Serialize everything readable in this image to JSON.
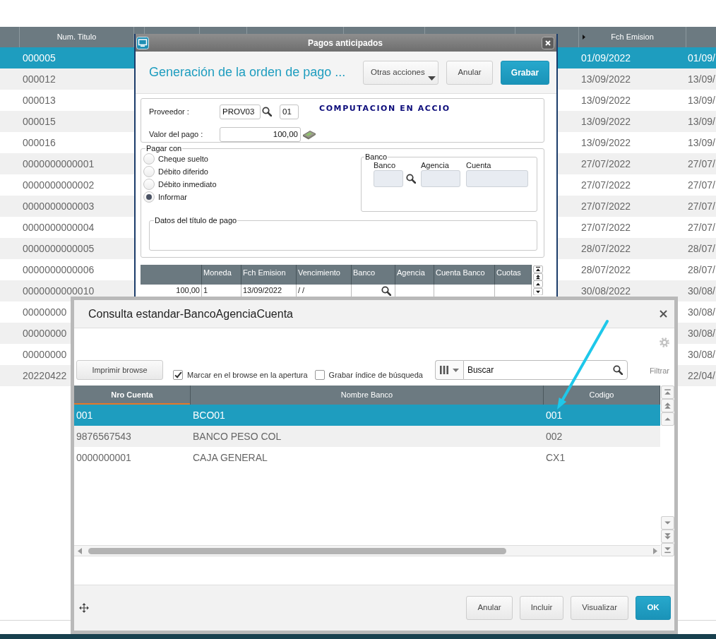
{
  "background_table": {
    "columns": [
      {
        "label": "Num. Titulo",
        "marker": false
      },
      {
        "label": "Fch Emision",
        "marker": true
      }
    ],
    "rows": [
      {
        "num_titulo": "000005",
        "fch_emision": "01/09/2022",
        "column_3": "01/09/",
        "selected": true
      },
      {
        "num_titulo": "000012",
        "fch_emision": "13/09/2022",
        "column_3": "13/09/",
        "selected": false
      },
      {
        "num_titulo": "000013",
        "fch_emision": "13/09/2022",
        "column_3": "13/09/",
        "selected": false
      },
      {
        "num_titulo": "000015",
        "fch_emision": "13/09/2022",
        "column_3": "13/09/",
        "selected": false
      },
      {
        "num_titulo": "000016",
        "fch_emision": "13/09/2022",
        "column_3": "13/09/",
        "selected": false
      },
      {
        "num_titulo": "0000000000001",
        "fch_emision": "27/07/2022",
        "column_3": "27/07/",
        "selected": false
      },
      {
        "num_titulo": "0000000000002",
        "fch_emision": "27/07/2022",
        "column_3": "27/07/",
        "selected": false
      },
      {
        "num_titulo": "0000000000003",
        "fch_emision": "27/07/2022",
        "column_3": "27/07/",
        "selected": false
      },
      {
        "num_titulo": "0000000000004",
        "fch_emision": "27/07/2022",
        "column_3": "27/07/",
        "selected": false
      },
      {
        "num_titulo": "0000000000005",
        "fch_emision": "28/07/2022",
        "column_3": "28/07/",
        "selected": false
      },
      {
        "num_titulo": "0000000000006",
        "fch_emision": "28/07/2022",
        "column_3": "28/07/",
        "selected": false
      },
      {
        "num_titulo": "0000000000010",
        "fch_emision": "30/08/2022",
        "column_3": "30/08/",
        "selected": false
      },
      {
        "num_titulo": "00000000",
        "column_3": "30/08/",
        "selected": false
      },
      {
        "num_titulo": "00000000",
        "column_3": "30/08/",
        "selected": false
      },
      {
        "num_titulo": "00000000",
        "column_3": "30/08/",
        "selected": false
      },
      {
        "num_titulo": "20220422",
        "column_3": "22/04/",
        "selected": false
      }
    ]
  },
  "dialog": {
    "title": "Pagos anticipados",
    "heading": "Generación de la orden de pago ...",
    "actions": [
      {
        "label": "Otras acciones",
        "kind": "menu"
      },
      {
        "label": "Anular",
        "kind": "secondary"
      },
      {
        "label": "Grabar",
        "kind": "primary"
      }
    ],
    "supplier": {
      "label": "Proveedor :",
      "code": "PROV03",
      "store": "01",
      "name": "COMPUTACION EN ACCIO"
    },
    "amount": {
      "label": "Valor del pago :",
      "value": "100,00"
    },
    "pay_with": {
      "legend": "Pagar con",
      "options": [
        {
          "label": "Cheque suelto",
          "selected": false
        },
        {
          "label": "Débito diferido",
          "selected": false
        },
        {
          "label": "Débito inmediato",
          "selected": false
        },
        {
          "label": "Informar",
          "selected": true
        }
      ]
    },
    "bank": {
      "legend": "Banco",
      "fields": [
        {
          "label": "Banco",
          "lookup": true
        },
        {
          "label": "Agencia",
          "lookup": false
        },
        {
          "label": "Cuenta",
          "lookup": false
        }
      ]
    },
    "payment_title_data": {
      "legend": "Datos del título de pago"
    },
    "grid": {
      "columns": [
        {
          "lookup": false
        },
        {
          "label": "Moneda",
          "lookup": false
        },
        {
          "label": "Fch Emision",
          "lookup": false
        },
        {
          "label": "Vencimiento",
          "lookup": false
        },
        {
          "label": "Banco",
          "lookup": true
        },
        {
          "label": "Agencia",
          "lookup": false
        },
        {
          "label": "Cuenta Banco",
          "lookup": false
        },
        {
          "label": "Cuotas",
          "lookup": false
        }
      ],
      "rows": [
        {
          "cells": [
            "100,00",
            "1",
            "13/09/2022",
            "/ /"
          ]
        }
      ]
    }
  },
  "lookup_dialog": {
    "title": "Consulta estandar-BancoAgenciaCuenta",
    "print_button": "Imprimir browse",
    "options": [
      {
        "label": "Marcar en el browse en la apertura",
        "checked": true
      },
      {
        "label": "Grabar índice de búsqueda",
        "checked": false
      }
    ],
    "search": {
      "value": "Buscar"
    },
    "filter_label": "Filtrar",
    "table": {
      "columns": [
        {
          "label": "Nro Cuenta",
          "sorted": true
        },
        {
          "label": "Nombre Banco",
          "sorted": false
        },
        {
          "label": "Codigo",
          "sorted": false
        }
      ],
      "rows": [
        {
          "cells": [
            "001",
            "BCO01",
            "001"
          ],
          "selected": true
        },
        {
          "cells": [
            "9876567543",
            "BANCO PESO COL",
            "002"
          ],
          "selected": false
        },
        {
          "cells": [
            "0000000001",
            "CAJA GENERAL",
            "CX1"
          ],
          "selected": false
        }
      ]
    },
    "buttons": [
      {
        "label": "Anular",
        "kind": "default"
      },
      {
        "label": "Incluir",
        "kind": "default"
      },
      {
        "label": "Visualizar",
        "kind": "default"
      },
      {
        "label": "OK",
        "kind": "primary"
      }
    ]
  }
}
